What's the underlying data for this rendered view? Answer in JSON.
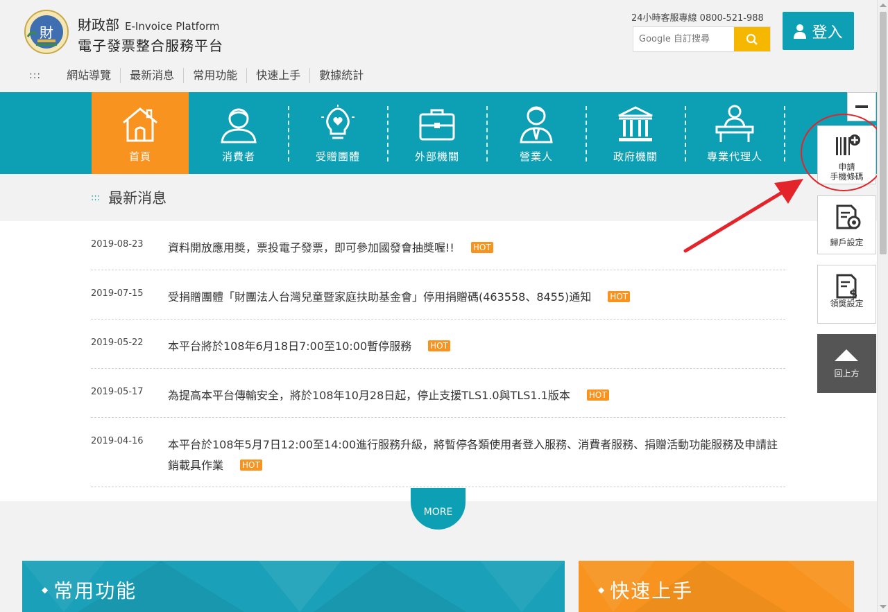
{
  "brand": {
    "ministry": "財政部",
    "english": "E-Invoice Platform",
    "platform": "電子發票整合服務平台"
  },
  "header": {
    "hotline": "24小時客服專線 0800-521-988",
    "search_placeholder": "Google 自訂搜尋",
    "login_label": "登入"
  },
  "topnav": {
    "dots": ":::",
    "items": [
      "網站導覽",
      "最新消息",
      "常用功能",
      "快速上手",
      "數據統計"
    ]
  },
  "mainnav": {
    "items": [
      {
        "label": "首頁",
        "icon": "home-icon"
      },
      {
        "label": "消費者",
        "icon": "consumer-icon"
      },
      {
        "label": "受贈團體",
        "icon": "lightbulb-heart-icon"
      },
      {
        "label": "外部機關",
        "icon": "briefcase-icon"
      },
      {
        "label": "營業人",
        "icon": "businessman-icon"
      },
      {
        "label": "政府機關",
        "icon": "government-building-icon"
      },
      {
        "label": "專業代理人",
        "icon": "agent-desk-icon"
      }
    ]
  },
  "news": {
    "dots": ":::",
    "heading": "最新消息",
    "hot_label": "HOT",
    "more_label": "MORE",
    "items": [
      {
        "date": "2019-08-23",
        "title": "資料開放應用獎，票投電子發票，即可參加國發會抽獎喔!!"
      },
      {
        "date": "2019-07-15",
        "title": "受捐贈團體「財團法人台灣兒童暨家庭扶助基金會」停用捐贈碼(463558、8455)通知"
      },
      {
        "date": "2019-05-22",
        "title": "本平台將於108年6月18日7:00至10:00暫停服務"
      },
      {
        "date": "2019-05-17",
        "title": "為提高本平台傳輸安全，將於108年10月28日起，停止支援TLS1.0與TLS1.1版本"
      },
      {
        "date": "2019-04-16",
        "title": "本平台於108年5月7日12:00至14:00進行服務升級，將暫停各類使用者登入服務、消費者服務、捐贈活動功能服務及申請註銷載具作業"
      }
    ]
  },
  "banners": {
    "common": "常用功能",
    "quick": "快速上手"
  },
  "sidebar": {
    "apply_line1": "申請",
    "apply_line2": "手機條碼",
    "account_settings": "歸戶設定",
    "prize_settings": "領獎設定",
    "back_to_top": "回上方"
  },
  "colors": {
    "teal": "#0d9fb4",
    "orange": "#f7931e",
    "search_button": "#f5b700",
    "annotation_red": "#e3242b"
  }
}
